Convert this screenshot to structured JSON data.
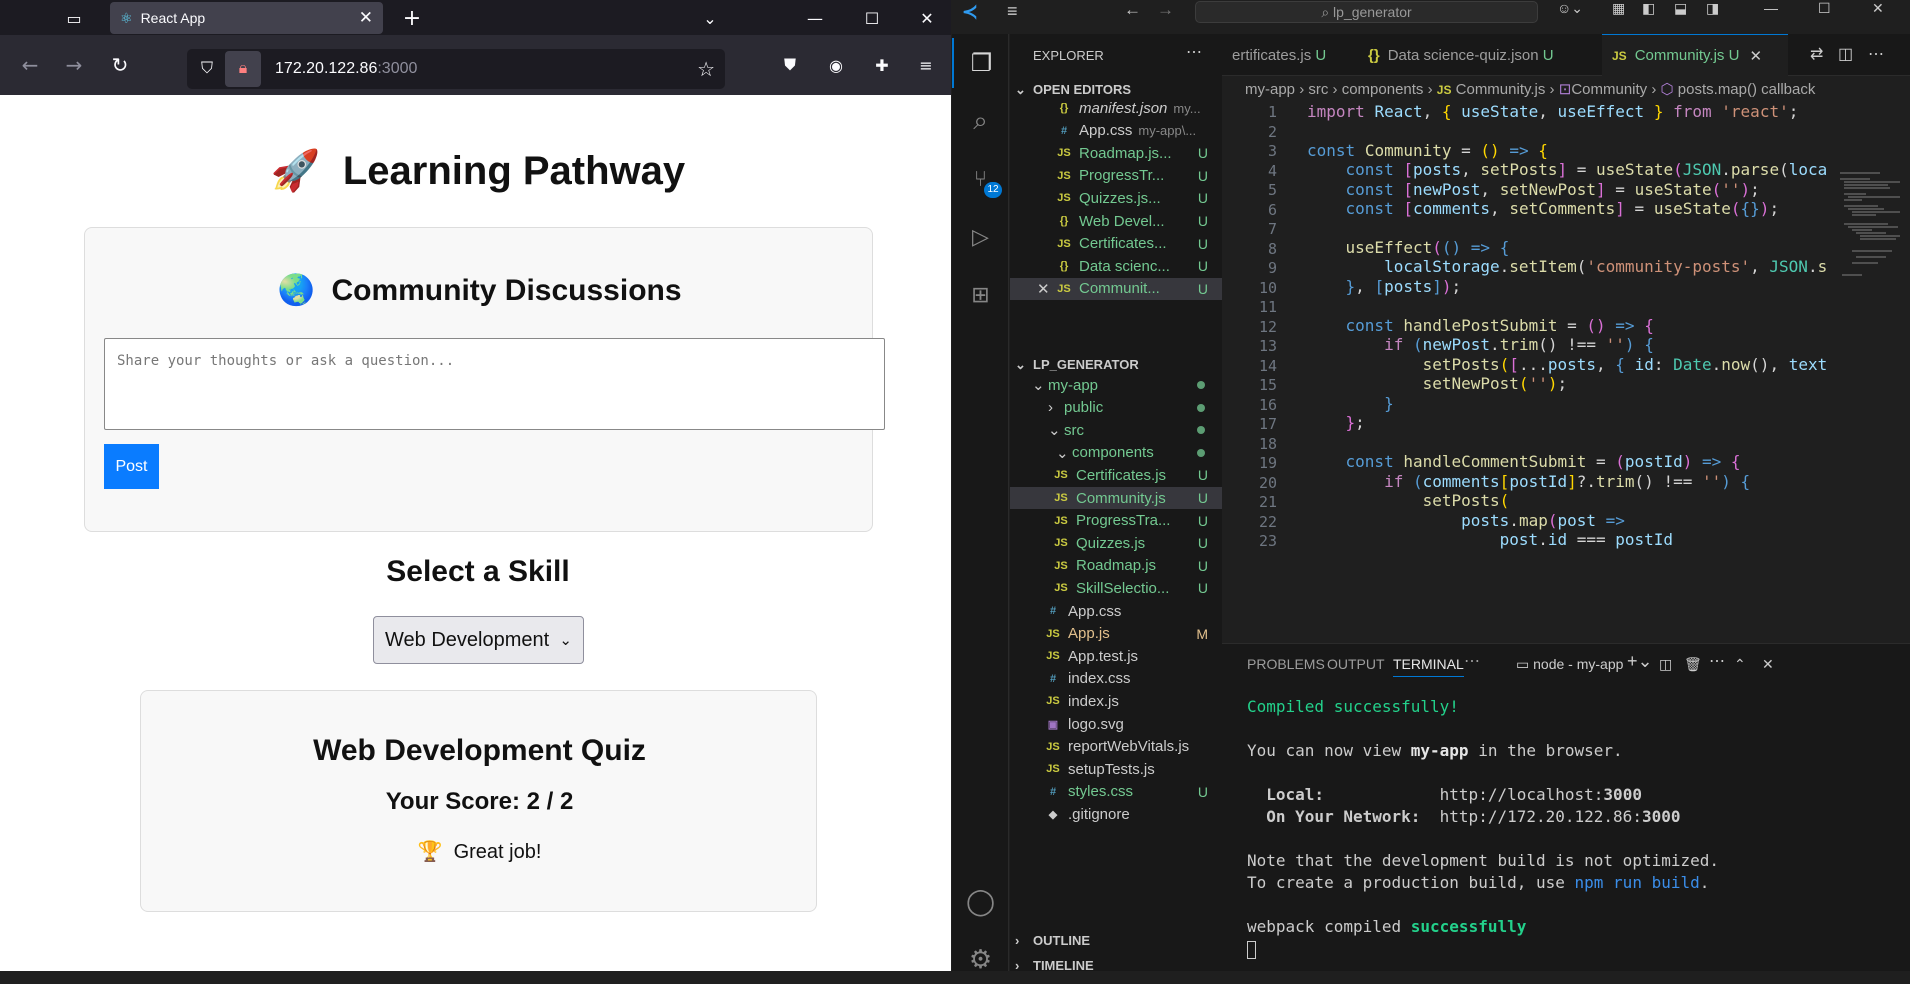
{
  "browser": {
    "tab_title": "React App",
    "url_host": "172.20.122.86",
    "url_port": ":3000"
  },
  "app": {
    "title_emoji": "🚀",
    "title": "Learning Pathway",
    "community": {
      "emoji": "🌏",
      "title": "Community Discussions",
      "placeholder": "Share your thoughts or ask a question...",
      "post_label": "Post"
    },
    "skill_heading": "Select a Skill",
    "skill_selected": "Web Development",
    "quiz": {
      "title": "Web Development Quiz",
      "score": "Your Score: 2 / 2",
      "emoji": "🏆",
      "message": "Great job!"
    }
  },
  "vscode": {
    "command_center": "lp_generator",
    "explorer_label": "EXPLORER",
    "open_editors_label": "OPEN EDITORS",
    "project_label": "LP_GENERATOR",
    "outline_label": "OUTLINE",
    "timeline_label": "TIMELINE",
    "scm_badge": "12",
    "open_editors": [
      {
        "icon": "{}",
        "name": "manifest.json",
        "extra": "my...",
        "status": ""
      },
      {
        "icon": "#",
        "name": "App.css",
        "extra": "my-app\\...",
        "status": ""
      },
      {
        "icon": "JS",
        "name": "Roadmap.js...",
        "extra": "",
        "status": "U"
      },
      {
        "icon": "JS",
        "name": "ProgressTr...",
        "extra": "",
        "status": "U"
      },
      {
        "icon": "JS",
        "name": "Quizzes.js...",
        "extra": "",
        "status": "U"
      },
      {
        "icon": "{}",
        "name": "Web Devel...",
        "extra": "",
        "status": "U"
      },
      {
        "icon": "JS",
        "name": "Certificates...",
        "extra": "",
        "status": "U"
      },
      {
        "icon": "{}",
        "name": "Data scienc...",
        "extra": "",
        "status": "U"
      },
      {
        "icon": "JS",
        "name": "Communit...",
        "extra": "",
        "status": "U"
      }
    ],
    "tree": [
      {
        "name": "my-app",
        "icon": "",
        "chev": "⌄",
        "status": "dot"
      },
      {
        "name": "public",
        "icon": "",
        "chev": "›",
        "status": "dot"
      },
      {
        "name": "src",
        "icon": "",
        "chev": "⌄",
        "status": "dot"
      },
      {
        "name": "components",
        "icon": "",
        "chev": "⌄",
        "status": "dot"
      },
      {
        "name": "Certificates.js",
        "icon": "JS",
        "chev": "",
        "status": "U"
      },
      {
        "name": "Community.js",
        "icon": "JS",
        "chev": "",
        "status": "U"
      },
      {
        "name": "ProgressTra...",
        "icon": "JS",
        "chev": "",
        "status": "U"
      },
      {
        "name": "Quizzes.js",
        "icon": "JS",
        "chev": "",
        "status": "U"
      },
      {
        "name": "Roadmap.js",
        "icon": "JS",
        "chev": "",
        "status": "U"
      },
      {
        "name": "SkillSelectio...",
        "icon": "JS",
        "chev": "",
        "status": "U"
      },
      {
        "name": "App.css",
        "icon": "#",
        "chev": "",
        "status": ""
      },
      {
        "name": "App.js",
        "icon": "JS",
        "chev": "",
        "status": "M"
      },
      {
        "name": "App.test.js",
        "icon": "JS",
        "chev": "",
        "status": ""
      },
      {
        "name": "index.css",
        "icon": "#",
        "chev": "",
        "status": ""
      },
      {
        "name": "index.js",
        "icon": "JS",
        "chev": "",
        "status": ""
      },
      {
        "name": "logo.svg",
        "icon": "▣",
        "chev": "",
        "status": ""
      },
      {
        "name": "reportWebVitals.js",
        "icon": "JS",
        "chev": "",
        "status": ""
      },
      {
        "name": "setupTests.js",
        "icon": "JS",
        "chev": "",
        "status": ""
      },
      {
        "name": "styles.css",
        "icon": "#",
        "chev": "",
        "status": "U"
      },
      {
        "name": ".gitignore",
        "icon": "◆",
        "chev": "",
        "status": ""
      }
    ],
    "tabs": [
      {
        "name": "ertificates.js",
        "status": "U"
      },
      {
        "name": "Data science-quiz.json",
        "status": "U"
      },
      {
        "name": "Community.js",
        "status": "U"
      }
    ],
    "breadcrumb": [
      "my-app",
      "src",
      "components",
      "Community.js",
      "Community",
      "posts.map() callback"
    ],
    "code_lines": [
      "1",
      "2",
      "3",
      "4",
      "5",
      "6",
      "7",
      "8",
      "9",
      "10",
      "11",
      "12",
      "13",
      "14",
      "15",
      "16",
      "17",
      "18",
      "19",
      "20",
      "21",
      "22",
      "23"
    ],
    "panel_tabs": [
      "PROBLEMS",
      "OUTPUT",
      "TERMINAL"
    ],
    "terminal_name": "node - my-app",
    "terminal": {
      "compiled": "Compiled successfully!",
      "view_prefix": "You can now view ",
      "app_name": "my-app",
      "view_suffix": " in the browser.",
      "local_label": "  Local:",
      "local_url_a": "http://localhost:",
      "local_url_b": "3000",
      "network_label": "  On Your Network:",
      "network_url_a": "http://172.20.122.86:",
      "network_url_b": "3000",
      "note1": "Note that the development build is not optimized.",
      "note2_a": "To create a production build, use ",
      "note2_b": "npm run build",
      "note2_c": ".",
      "webpack_a": "webpack compiled ",
      "webpack_b": "successfully"
    }
  }
}
